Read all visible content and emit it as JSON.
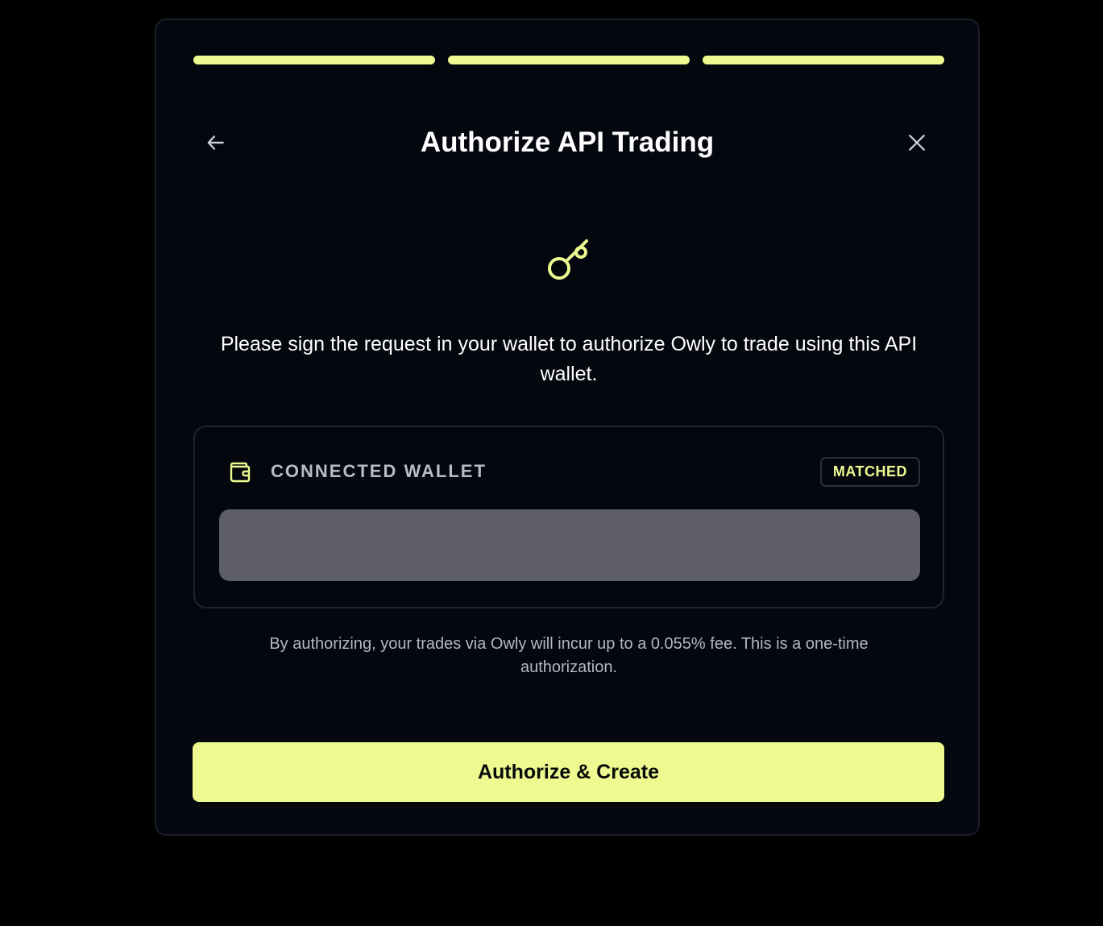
{
  "colors": {
    "accent": "#ecfa8f",
    "background": "#05070f",
    "page_background": "#000000"
  },
  "progress": {
    "steps_total": 3,
    "steps_completed": 3
  },
  "header": {
    "title": "Authorize API Trading",
    "back_icon": "arrow-left-icon",
    "close_icon": "close-icon"
  },
  "hero": {
    "icon": "key-icon"
  },
  "description": "Please sign the request in your wallet to authorize Owly to trade using this API wallet.",
  "wallet_card": {
    "icon": "wallet-icon",
    "label": "CONNECTED WALLET",
    "badge": "MATCHED",
    "address": ""
  },
  "fee_note": "By authorizing, your trades via Owly will incur up to a 0.055% fee. This is a one-time authorization.",
  "cta": {
    "label": "Authorize & Create"
  }
}
